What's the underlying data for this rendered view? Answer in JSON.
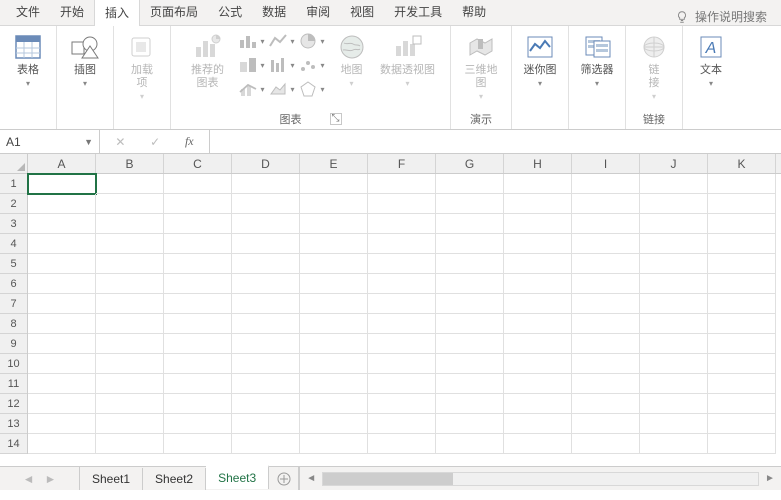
{
  "tabs": {
    "items": [
      "文件",
      "开始",
      "插入",
      "页面布局",
      "公式",
      "数据",
      "审阅",
      "视图",
      "开发工具",
      "帮助"
    ],
    "active_index": 2,
    "search_hint": "操作说明搜索"
  },
  "ribbon": {
    "tables": {
      "btn": "表格"
    },
    "illustrations": {
      "btn": "插图"
    },
    "addins": {
      "btn": "加载\n项",
      "disabled": true
    },
    "charts": {
      "label": "图表",
      "recommended": "推荐的\n图表",
      "map": "地图",
      "pivotchart": "数据透视图"
    },
    "tours": {
      "label": "演示",
      "map3d": "三维地\n图"
    },
    "sparklines": {
      "btn": "迷你图"
    },
    "filters": {
      "btn": "筛选器"
    },
    "links": {
      "label": "链接",
      "btn": "链\n接"
    },
    "text": {
      "btn": "文本"
    }
  },
  "fbar": {
    "namebox": "A1",
    "formula": ""
  },
  "sheet": {
    "cols": [
      "A",
      "B",
      "C",
      "D",
      "E",
      "F",
      "G",
      "H",
      "I",
      "J",
      "K"
    ],
    "rows": [
      1,
      2,
      3,
      4,
      5,
      6,
      7,
      8,
      9,
      10,
      11,
      12,
      13,
      14
    ],
    "active_cell": "A1"
  },
  "bottom": {
    "tabs": [
      "Sheet1",
      "Sheet2",
      "Sheet3"
    ],
    "active_index": 2
  }
}
